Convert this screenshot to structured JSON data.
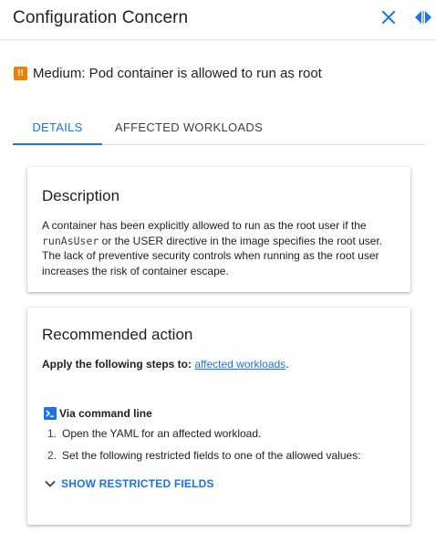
{
  "header": {
    "title": "Configuration Concern",
    "close_icon": "close-icon",
    "resize_icon": "panel-resize-icon",
    "accent_color": "#1a73e8"
  },
  "severity": {
    "icon": "warning-icon",
    "icon_glyph": "!!",
    "icon_color": "#f57c00",
    "text": "Medium: Pod container is allowed to run as root"
  },
  "tabs": [
    {
      "label": "DETAILS",
      "active": true
    },
    {
      "label": "AFFECTED WORKLOADS",
      "active": false
    }
  ],
  "description": {
    "title": "Description",
    "text_before_code": "A container has been explicitly allowed to run as the root user if the ",
    "code": "runAsUser",
    "text_after_code": " or the USER directive in the image specifies the root user. The lack of preventive security controls when running as the root user increases the risk of container escape."
  },
  "recommended": {
    "title": "Recommended action",
    "apply_prefix": "Apply the following steps to:",
    "apply_link": "affected workloads",
    "apply_suffix": ".",
    "cli_icon": "terminal-icon",
    "cli_label": "Via command line",
    "steps": [
      {
        "num": "1.",
        "text": "Open the YAML for an affected workload."
      },
      {
        "num": "2.",
        "text": "Set the following restricted fields to one of the allowed values:"
      }
    ],
    "show_icon": "chevron-down-icon",
    "show_label": "SHOW RESTRICTED FIELDS"
  }
}
